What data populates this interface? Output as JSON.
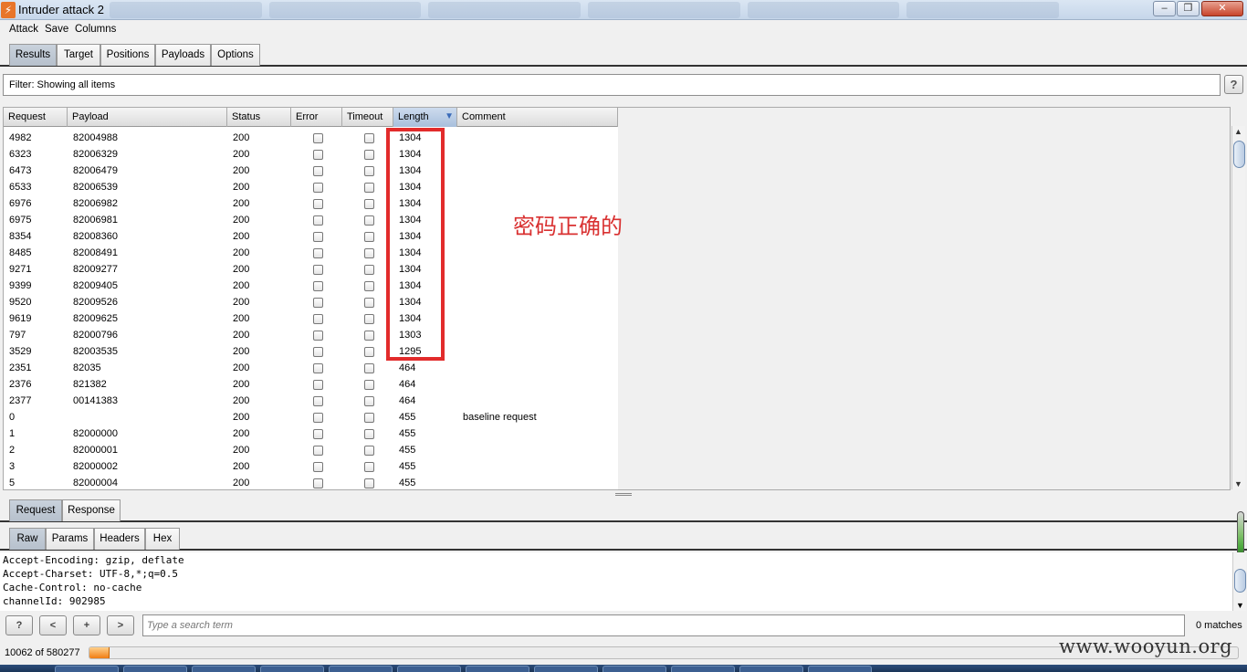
{
  "window": {
    "title": "Intruder attack 2",
    "controls": {
      "minimize": "‒",
      "maximize": "❐",
      "close": "✕"
    }
  },
  "menu": [
    "Attack",
    "Save",
    "Columns"
  ],
  "tabs": [
    "Results",
    "Target",
    "Positions",
    "Payloads",
    "Options"
  ],
  "active_tab": "Results",
  "filter": {
    "text": "Filter: Showing all items",
    "help": "?"
  },
  "table": {
    "columns": [
      "Request",
      "Payload",
      "Status",
      "Error",
      "Timeout",
      "Length",
      "Comment"
    ],
    "sorted_column": "Length",
    "sort_direction": "descending",
    "rows": [
      [
        "4982",
        "82004988",
        "200",
        "1304",
        ""
      ],
      [
        "6323",
        "82006329",
        "200",
        "1304",
        ""
      ],
      [
        "6473",
        "82006479",
        "200",
        "1304",
        ""
      ],
      [
        "6533",
        "82006539",
        "200",
        "1304",
        ""
      ],
      [
        "6976",
        "82006982",
        "200",
        "1304",
        ""
      ],
      [
        "6975",
        "82006981",
        "200",
        "1304",
        ""
      ],
      [
        "8354",
        "82008360",
        "200",
        "1304",
        ""
      ],
      [
        "8485",
        "82008491",
        "200",
        "1304",
        ""
      ],
      [
        "9271",
        "82009277",
        "200",
        "1304",
        ""
      ],
      [
        "9399",
        "82009405",
        "200",
        "1304",
        ""
      ],
      [
        "9520",
        "82009526",
        "200",
        "1304",
        ""
      ],
      [
        "9619",
        "82009625",
        "200",
        "1304",
        ""
      ],
      [
        "797",
        "82000796",
        "200",
        "1303",
        ""
      ],
      [
        "3529",
        "82003535",
        "200",
        "1295",
        ""
      ],
      [
        "2351",
        "82035",
        "200",
        "464",
        ""
      ],
      [
        "2376",
        "821382",
        "200",
        "464",
        ""
      ],
      [
        "2377",
        "00141383",
        "200",
        "464",
        ""
      ],
      [
        "0",
        "",
        "200",
        "455",
        "baseline request"
      ],
      [
        "1",
        "82000000",
        "200",
        "455",
        ""
      ],
      [
        "2",
        "82000001",
        "200",
        "455",
        ""
      ],
      [
        "3",
        "82000002",
        "200",
        "455",
        ""
      ],
      [
        "5",
        "82000004",
        "200",
        "455",
        ""
      ]
    ]
  },
  "annotation": "密码正确的",
  "detail_tabs": [
    "Request",
    "Response"
  ],
  "active_detail_tab": "Request",
  "view_tabs": [
    "Raw",
    "Params",
    "Headers",
    "Hex"
  ],
  "active_view_tab": "Raw",
  "raw_lines": [
    "Accept-Encoding: gzip, deflate",
    "Accept-Charset: UTF-8,*;q=0.5",
    "Cache-Control: no-cache",
    "channelId: 902985"
  ],
  "search": {
    "buttons": [
      "?",
      "<",
      "+",
      ">"
    ],
    "placeholder": "Type a search term",
    "matches": "0 matches"
  },
  "progress": {
    "text": "10062 of 580277",
    "completed": 10062,
    "total": 580277
  },
  "watermark": "www.wooyun.org",
  "colors": {
    "highlight": "#e22b2b",
    "progress": "#f07d12",
    "active_tab": "#b6c0cc"
  },
  "icons": {
    "app": "burp-logo-icon",
    "sort": "sort-descending-icon",
    "scroll_up": "arrow-up-icon",
    "scroll_down": "arrow-down-icon"
  }
}
